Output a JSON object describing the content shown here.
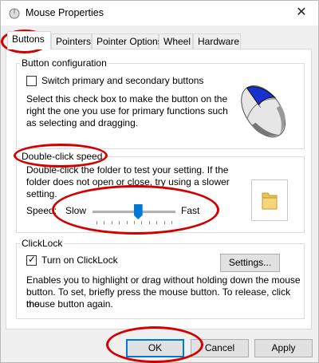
{
  "window": {
    "title": "Mouse Properties",
    "close_glyph": "✕"
  },
  "tabs": [
    {
      "label": "Buttons",
      "active": true
    },
    {
      "label": "Pointers"
    },
    {
      "label": "Pointer Options"
    },
    {
      "label": "Wheel"
    },
    {
      "label": "Hardware"
    }
  ],
  "button_config": {
    "title": "Button configuration",
    "switch_label": "Switch primary and secondary buttons",
    "switch_checked": false,
    "description_lines": [
      "Select this check box to make the button on the",
      "right the one you use for primary functions such",
      "as selecting and dragging."
    ]
  },
  "double_click": {
    "title": "Double-click speed",
    "description_lines": [
      "Double-click the folder to test your setting. If the",
      "folder does not open or close, try using a slower",
      "setting."
    ],
    "speed_label": "Speed:",
    "slow_label": "Slow",
    "fast_label": "Fast",
    "speed_level": 0.55
  },
  "clicklock": {
    "title": "ClickLock",
    "checkbox_label": "Turn on ClickLock",
    "checked": true,
    "check_glyph": "✓",
    "settings_button": "Settings...",
    "description_lines": [
      "Enables you to highlight or drag without holding down the mouse",
      "button. To set, briefly press the mouse button. To release, click the",
      "mouse button again."
    ]
  },
  "footer": {
    "ok": "OK",
    "cancel": "Cancel",
    "apply": "Apply"
  },
  "colors": {
    "annotation_red": "#d40000",
    "focus_blue": "#0078d7",
    "slider_thumb": "#0078d7"
  }
}
